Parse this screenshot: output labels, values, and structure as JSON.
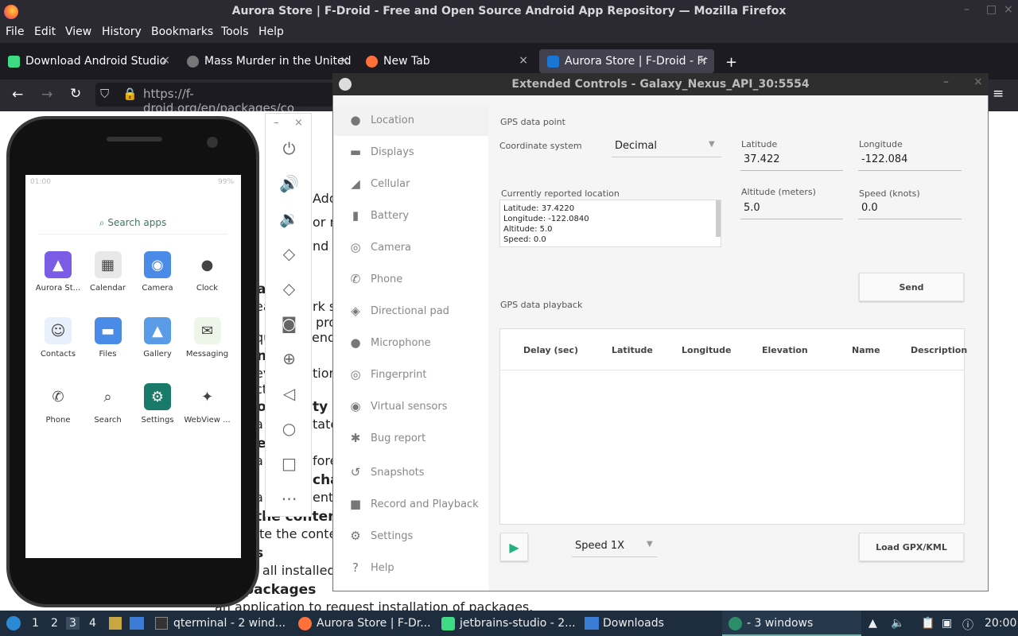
{
  "window": {
    "title": "Aurora Store | F-Droid - Free and Open Source Android App Repository — Mozilla Firefox"
  },
  "menu": [
    "File",
    "Edit",
    "View",
    "History",
    "Bookmarks",
    "Tools",
    "Help"
  ],
  "tabs": [
    {
      "label": "Download Android Studio",
      "close": "×"
    },
    {
      "label": "Mass Murder in the United",
      "close": "×"
    },
    {
      "label": "New Tab",
      "close": "×"
    },
    {
      "label": "Aurora Store | F-Droid - Fr",
      "close": "×"
    }
  ],
  "newtab": "+",
  "url": "https://f-droid.org/en/packages/co",
  "page_fragments": [
    "Add",
    "or n",
    "nd g",
    "a",
    "ea",
    "rk se",
    "pro",
    "qu",
    "end",
    "n",
    "ev",
    "tion",
    "ct",
    "o",
    "ty",
    "a",
    "tate",
    "er",
    "a",
    "fore",
    "cha",
    "a",
    "ents",
    "the contents",
    "rite the content",
    "s",
    "e all installed pa",
    "packages",
    "an application to request installation of packages."
  ],
  "phone": {
    "time": "01:00",
    "battery": "99%",
    "search": "Search apps",
    "apps": [
      {
        "name": "Aurora St...",
        "icon": "aurora-store-icon",
        "color": "#7b5ce6"
      },
      {
        "name": "Calendar",
        "icon": "calendar-icon",
        "color": "#e8e8e8"
      },
      {
        "name": "Camera",
        "icon": "camera-icon",
        "color": "#4a8be8"
      },
      {
        "name": "Clock",
        "icon": "clock-icon",
        "color": "#ffffff"
      },
      {
        "name": "Contacts",
        "icon": "contacts-icon",
        "color": "#e8f0fb"
      },
      {
        "name": "Files",
        "icon": "files-icon",
        "color": "#4a8be8"
      },
      {
        "name": "Gallery",
        "icon": "gallery-icon",
        "color": "#5a9be8"
      },
      {
        "name": "Messaging",
        "icon": "messaging-icon",
        "color": "#eef6ea"
      },
      {
        "name": "Phone",
        "icon": "phone-icon",
        "color": "#ffffff"
      },
      {
        "name": "Search",
        "icon": "search-icon",
        "color": "#ffffff"
      },
      {
        "name": "Settings",
        "icon": "settings-icon",
        "color": "#1a7a6a"
      },
      {
        "name": "WebView ...",
        "icon": "webview-icon",
        "color": "#ffffff"
      }
    ]
  },
  "emulator_toolbar": {
    "min": "–",
    "close": "×"
  },
  "ext": {
    "title": "Extended Controls - Galaxy_Nexus_API_30:5554",
    "sidebar": [
      "Location",
      "Displays",
      "Cellular",
      "Battery",
      "Camera",
      "Phone",
      "Directional pad",
      "Microphone",
      "Fingerprint",
      "Virtual sensors",
      "Bug report",
      "Snapshots",
      "Record and Playback",
      "Settings",
      "Help"
    ],
    "gps_point": "GPS data point",
    "coord_label": "Coordinate system",
    "coord_value": "Decimal",
    "lat_label": "Latitude",
    "lat_value": "37.422",
    "lon_label": "Longitude",
    "lon_value": "-122.084",
    "alt_label": "Altitude (meters)",
    "alt_value": "5.0",
    "speed_label": "Speed (knots)",
    "speed_value": "0.0",
    "reported_label": "Currently reported location",
    "reported_lines": [
      "Latitude: 37.4220",
      "Longitude: -122.0840",
      "Altitude: 5.0",
      "Speed: 0.0"
    ],
    "send": "Send",
    "playback": "GPS data playback",
    "cols": [
      "Delay (sec)",
      "Latitude",
      "Longitude",
      "Elevation",
      "Name",
      "Description"
    ],
    "speed_sel": "Speed 1X",
    "load": "Load GPX/KML"
  },
  "taskbar": {
    "desktops": [
      "1",
      "2",
      "3",
      "4"
    ],
    "items": [
      "qterminal - 2 wind...",
      "Aurora Store | F-Dr...",
      "jetbrains-studio - 2...",
      "Downloads",
      "- 3 windows"
    ],
    "clock": "20:00"
  }
}
